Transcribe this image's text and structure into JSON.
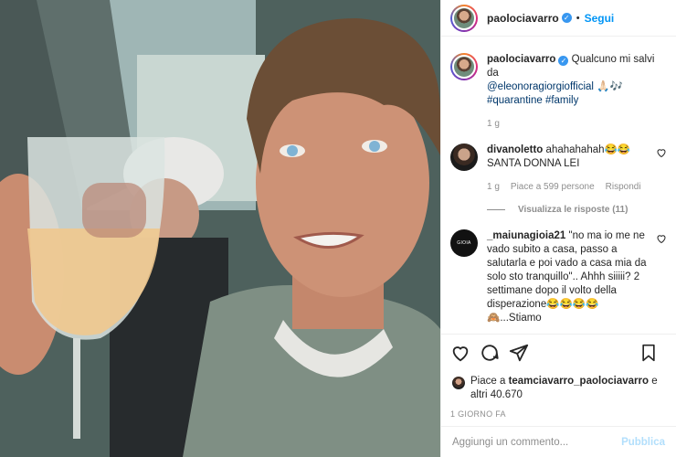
{
  "photo": {
    "alt_icon": "selfie-photo"
  },
  "header": {
    "username": "paolociavarro",
    "separator": "•",
    "follow_label": "Segui"
  },
  "caption": {
    "username": "paolociavarro",
    "text": "Qualcuno mi salvi da",
    "mention": "@eleonoragiorgiofficial",
    "emojis": "🙏🏻🎶",
    "hashtags": "#quarantine #family",
    "time": "1 g"
  },
  "comments": [
    {
      "username": "divanoletto",
      "text": "ahahahahah😂😂 SANTA DONNA LEI",
      "time": "1 g",
      "likes": "Piace a 599 persone",
      "reply": "Rispondi",
      "view_replies": "Visualizza le risposte (11)"
    },
    {
      "username": "_maiunagioia21",
      "avatar_text": "GIOIA",
      "text": "\"no ma io me ne vado subito a casa, passo a salutarla e poi vado a casa mia da solo sto tranquillo\".. Ahhh siiiii? 2 settimane dopo il volto della disperazione😂😂😂😂🙈...Stiamo"
    }
  ],
  "likes": {
    "prefix": "Piace a",
    "user": "teamciavarro_paolociavarro",
    "suffix": "e altri 40.670"
  },
  "timestamp": "1 GIORNO FA",
  "add_comment": {
    "placeholder": "Aggiungi un commento...",
    "publish_label": "Pubblica"
  },
  "colors": {
    "accent": "#0095f6",
    "verified": "#3897f0",
    "publish_disabled": "#b2dffc",
    "muted": "#8e8e8e"
  }
}
